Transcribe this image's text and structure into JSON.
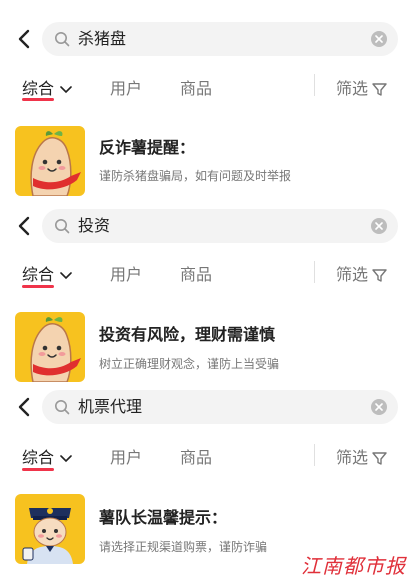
{
  "panels": [
    {
      "search_query": "杀猪盘",
      "tabs": [
        {
          "label": "综合",
          "active": true
        },
        {
          "label": "用户",
          "active": false
        },
        {
          "label": "商品",
          "active": false
        }
      ],
      "filter_label": "筛选",
      "result": {
        "title": "反诈薯提醒：",
        "description": "谨防杀猪盘骗局，如有问题及时举报",
        "thumbnail": "sweet-potato-mascot"
      }
    },
    {
      "search_query": "投资",
      "tabs": [
        {
          "label": "综合",
          "active": true
        },
        {
          "label": "用户",
          "active": false
        },
        {
          "label": "商品",
          "active": false
        }
      ],
      "filter_label": "筛选",
      "result": {
        "title": "投资有风险，理财需谨慎",
        "description": "树立正确理财观念，谨防上当受骗",
        "thumbnail": "sweet-potato-mascot"
      }
    },
    {
      "search_query": "机票代理",
      "tabs": [
        {
          "label": "综合",
          "active": true
        },
        {
          "label": "用户",
          "active": false
        },
        {
          "label": "商品",
          "active": false
        }
      ],
      "filter_label": "筛选",
      "result": {
        "title": "薯队长温馨提示：",
        "description": "请选择正规渠道购票，谨防诈骗",
        "thumbnail": "police-mascot"
      }
    }
  ],
  "watermark": "江南都市报",
  "colors": {
    "accent": "#f0344a",
    "thumbnail_bg": "#f7c21f",
    "search_bg": "#f3f3f3"
  }
}
